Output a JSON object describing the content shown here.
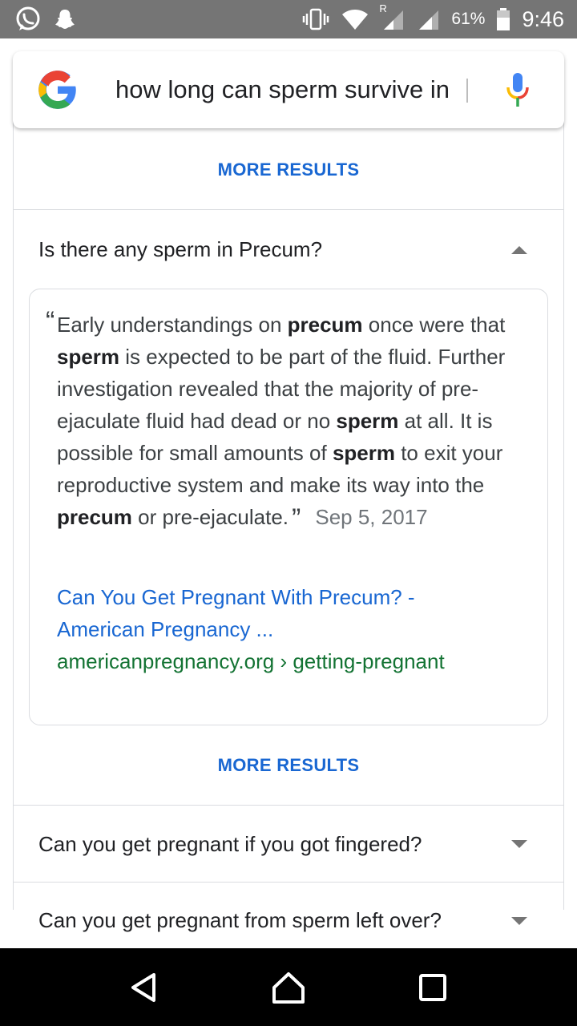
{
  "status_bar": {
    "battery_percent": "61%",
    "time": "9:46",
    "roaming_indicator": "R",
    "icons": [
      "whatsapp-icon",
      "snapchat-icon",
      "vibrate-icon",
      "wifi-icon",
      "signal-roaming-icon",
      "signal-icon",
      "battery-icon"
    ]
  },
  "search": {
    "query": "how long can sperm survive in"
  },
  "more_results_top": "MORE RESULTS",
  "faq_open": {
    "question": "Is there any sperm in Precum?",
    "answer": {
      "segments": [
        {
          "t": "Early understandings on ",
          "b": false
        },
        {
          "t": "precum",
          "b": true
        },
        {
          "t": " once were that ",
          "b": false
        },
        {
          "t": "sperm",
          "b": true
        },
        {
          "t": " is expected to be part of the fluid. Further investigation revealed that the majority of pre-ejaculate fluid had dead or no ",
          "b": false
        },
        {
          "t": "sperm",
          "b": true
        },
        {
          "t": " at all. It is possible for small amounts of ",
          "b": false
        },
        {
          "t": "sperm",
          "b": true
        },
        {
          "t": " to exit your reproductive system and make its way into the ",
          "b": false
        },
        {
          "t": "precum",
          "b": true
        },
        {
          "t": " or pre-ejaculate.",
          "b": false
        }
      ],
      "open_quote": "“",
      "close_quote": "”",
      "date": "Sep 5, 2017",
      "link_title_line1": "Can You Get Pregnant With Precum? -",
      "link_title_line2": "American Pregnancy ...",
      "url": "americanpregnancy.org › getting-pregnant"
    }
  },
  "more_results_bottom": "MORE RESULTS",
  "faq_collapsed": [
    {
      "question": "Can you get pregnant if you got fingered?"
    },
    {
      "question": "Can you get pregnant from sperm left over?"
    }
  ],
  "colors": {
    "status_bar": "#757575",
    "link_blue": "#1a73e8",
    "url_green": "#137333",
    "more_results_blue": "#1967d2"
  }
}
